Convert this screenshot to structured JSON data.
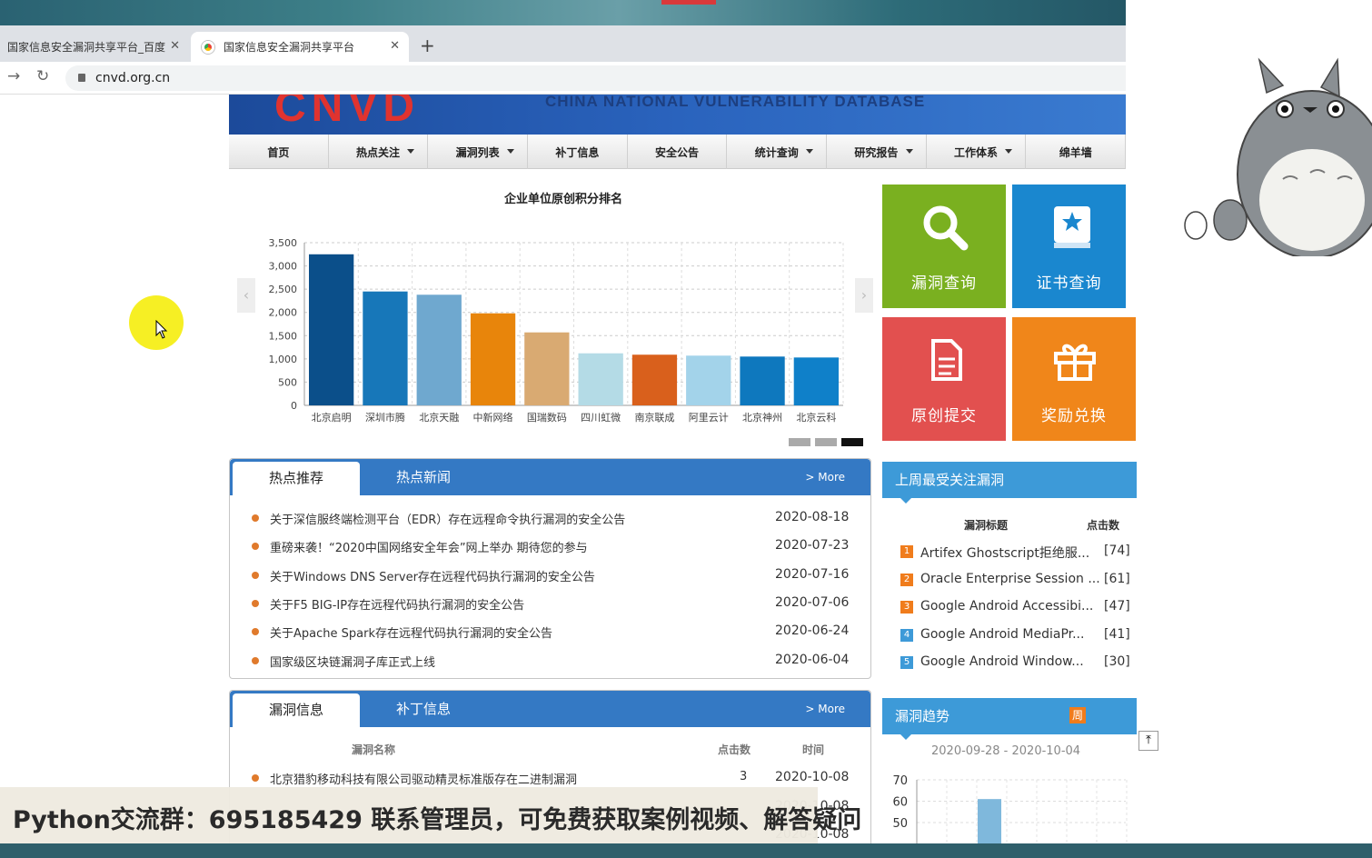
{
  "browser": {
    "tabs": [
      {
        "title": "国家信息安全漏洞共享平台_百度"
      },
      {
        "title": "国家信息安全漏洞共享平台"
      }
    ],
    "url": "cnvd.org.cn"
  },
  "site": {
    "logo_text": "CNVD",
    "logo_subtitle": "CHINA NATIONAL VULNERABILITY DATABASE"
  },
  "menu": [
    {
      "label": "首页",
      "dropdown": false
    },
    {
      "label": "热点关注",
      "dropdown": true
    },
    {
      "label": "漏洞列表",
      "dropdown": true
    },
    {
      "label": "补丁信息",
      "dropdown": false
    },
    {
      "label": "安全公告",
      "dropdown": false
    },
    {
      "label": "统计查询",
      "dropdown": true
    },
    {
      "label": "研究报告",
      "dropdown": true
    },
    {
      "label": "工作体系",
      "dropdown": true
    },
    {
      "label": "绵羊墙",
      "dropdown": false
    }
  ],
  "chart_data": {
    "type": "bar",
    "title": "企业单位原创积分排名",
    "categories": [
      "北京启明",
      "深圳市腾",
      "北京天融",
      "中新网络",
      "国瑞数码",
      "四川虹微",
      "南京联成",
      "阿里云计",
      "北京神州",
      "北京云科"
    ],
    "values": [
      3250,
      2450,
      2380,
      1980,
      1570,
      1120,
      1090,
      1070,
      1050,
      1030
    ],
    "colors": [
      "#0b4f8a",
      "#1777b9",
      "#6fa8cf",
      "#e8850b",
      "#d9aa72",
      "#b4dbe6",
      "#d9601c",
      "#a3d3ea",
      "#0e78be",
      "#0f80c9"
    ],
    "yticks": [
      "0",
      "500",
      "1,000",
      "1,500",
      "2,000",
      "2,500",
      "3,000",
      "3,500"
    ],
    "ylim": [
      0,
      3500
    ],
    "grid": true
  },
  "tiles": [
    {
      "label": "漏洞查询",
      "color": "#7ab020",
      "icon": "search-icon"
    },
    {
      "label": "证书查询",
      "color": "#1a87cf",
      "icon": "certificate-icon"
    },
    {
      "label": "原创提交",
      "color": "#e2504f",
      "icon": "document-icon"
    },
    {
      "label": "奖励兑换",
      "color": "#f0861a",
      "icon": "gift-icon"
    }
  ],
  "hot": {
    "tab_active": "热点推荐",
    "tab_inactive": "热点新闻",
    "more": "> More",
    "items": [
      {
        "title": "关于深信服终端检测平台（EDR）存在远程命令执行漏洞的安全公告",
        "date": "2020-08-18"
      },
      {
        "title": "重磅来袭！“2020中国网络安全年会”网上举办 期待您的参与",
        "date": "2020-07-23"
      },
      {
        "title": "关于Windows DNS Server存在远程代码执行漏洞的安全公告",
        "date": "2020-07-16"
      },
      {
        "title": "关于F5 BIG-IP存在远程代码执行漏洞的安全公告",
        "date": "2020-07-06"
      },
      {
        "title": "关于Apache Spark存在远程代码执行漏洞的安全公告",
        "date": "2020-06-24"
      },
      {
        "title": "国家级区块链漏洞子库正式上线",
        "date": "2020-06-04"
      }
    ]
  },
  "vuln": {
    "tab_active": "漏洞信息",
    "tab_inactive": "补丁信息",
    "more": "> More",
    "col_name": "漏洞名称",
    "col_clicks": "点击数",
    "col_time": "时间",
    "items": [
      {
        "title": "北京猎豹移动科技有限公司驱动精灵标准版存在二进制漏洞",
        "clicks": "3",
        "date": "2020-10-08"
      },
      {
        "title": "",
        "clicks": "",
        "date": "2020-10-08"
      },
      {
        "title": "",
        "clicks": "",
        "date": "2020-10-08"
      }
    ]
  },
  "weekly": {
    "title": "上周最受关注漏洞",
    "col_title": "漏洞标题",
    "col_clicks": "点击数",
    "items": [
      {
        "rank": "1",
        "title": "Artifex Ghostscript拒绝服...",
        "clicks": "[74]",
        "color": "#f07c1c"
      },
      {
        "rank": "2",
        "title": "Oracle Enterprise Session ...",
        "clicks": "[61]",
        "color": "#f07c1c"
      },
      {
        "rank": "3",
        "title": "Google Android Accessibi...",
        "clicks": "[47]",
        "color": "#f07c1c"
      },
      {
        "rank": "4",
        "title": "Google Android MediaPr...",
        "clicks": "[41]",
        "color": "#3d9ad8"
      },
      {
        "rank": "5",
        "title": "Google Android Window...",
        "clicks": "[30]",
        "color": "#3d9ad8"
      }
    ]
  },
  "trend": {
    "title": "漏洞趋势",
    "period_button": "周",
    "date_range": "2020-09-28 - 2020-10-04",
    "yticks": [
      "70",
      "60",
      "50"
    ],
    "bar_value": 61
  },
  "footer_banner": "Python交流群：695185429 联系管理员，可免费获取案例视频、解答疑问"
}
